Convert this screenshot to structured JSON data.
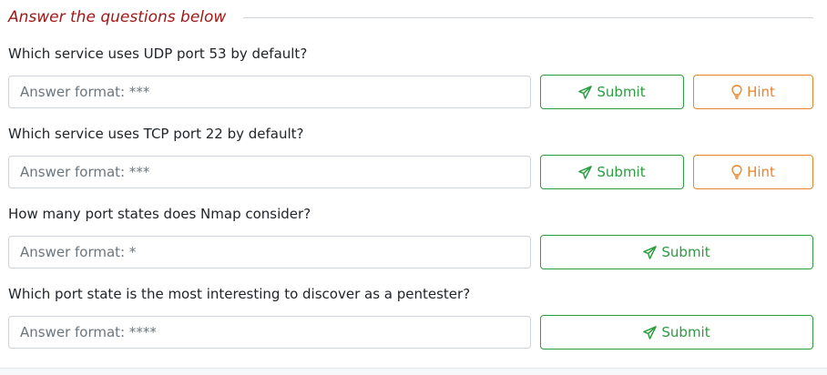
{
  "header": {
    "title": "Answer the questions below",
    "title_color": "#a01919"
  },
  "questions": [
    {
      "text": "Which service uses UDP port 53 by default?",
      "placeholder": "Answer format: ***",
      "submit_label": "Submit",
      "hint_label": "Hint"
    },
    {
      "text": "Which service uses TCP port 22 by default?",
      "placeholder": "Answer format: ***",
      "submit_label": "Submit",
      "hint_label": "Hint"
    },
    {
      "text": "How many port states does Nmap consider?",
      "placeholder": "Answer format: *",
      "submit_label": "Submit"
    },
    {
      "text": "Which port state is the most interesting to discover as a pentester?",
      "placeholder": "Answer format: ****",
      "submit_label": "Submit"
    }
  ],
  "icons": {
    "submit": "paper-plane-icon",
    "hint": "lightbulb-icon"
  },
  "colors": {
    "submit": "#2a9d3f",
    "hint": "#e8842b",
    "border": "#ced4da"
  }
}
